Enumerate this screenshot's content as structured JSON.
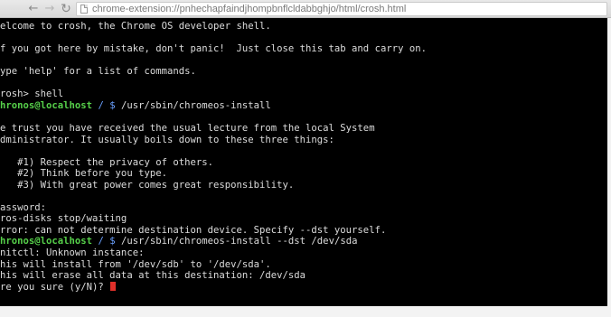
{
  "browser": {
    "url": "chrome-extension://pnhechapfaindjhompbnflcldabbghjo/html/crosh.html"
  },
  "terminal": {
    "lines": [
      {
        "text": "elcome to crosh, the Chrome OS developer shell."
      },
      {
        "text": ""
      },
      {
        "text": "f you got here by mistake, don't panic!  Just close this tab and carry on."
      },
      {
        "text": ""
      },
      {
        "text": "ype 'help' for a list of commands."
      },
      {
        "text": ""
      },
      {
        "text": "rosh> shell"
      },
      {
        "user": "hronos@localhost",
        "path": " / $",
        "cmd": " /usr/sbin/chromeos-install"
      },
      {
        "text": ""
      },
      {
        "text": "e trust you have received the usual lecture from the local System"
      },
      {
        "text": "dministrator. It usually boils down to these three things:"
      },
      {
        "text": ""
      },
      {
        "text": "   #1) Respect the privacy of others."
      },
      {
        "text": "   #2) Think before you type."
      },
      {
        "text": "   #3) With great power comes great responsibility."
      },
      {
        "text": ""
      },
      {
        "text": "assword:"
      },
      {
        "text": "ros-disks stop/waiting"
      },
      {
        "text": "rror: can not determine destination device. Specify --dst yourself."
      },
      {
        "user": "hronos@localhost",
        "path": " / $",
        "cmd": " /usr/sbin/chromeos-install --dst /dev/sda"
      },
      {
        "text": "nitctl: Unknown instance:"
      },
      {
        "text": "his will install from '/dev/sdb' to '/dev/sda'."
      },
      {
        "text": "his will erase all data at this destination: /dev/sda"
      },
      {
        "text": "re you sure (y/N)? ",
        "cursor": true
      }
    ]
  }
}
